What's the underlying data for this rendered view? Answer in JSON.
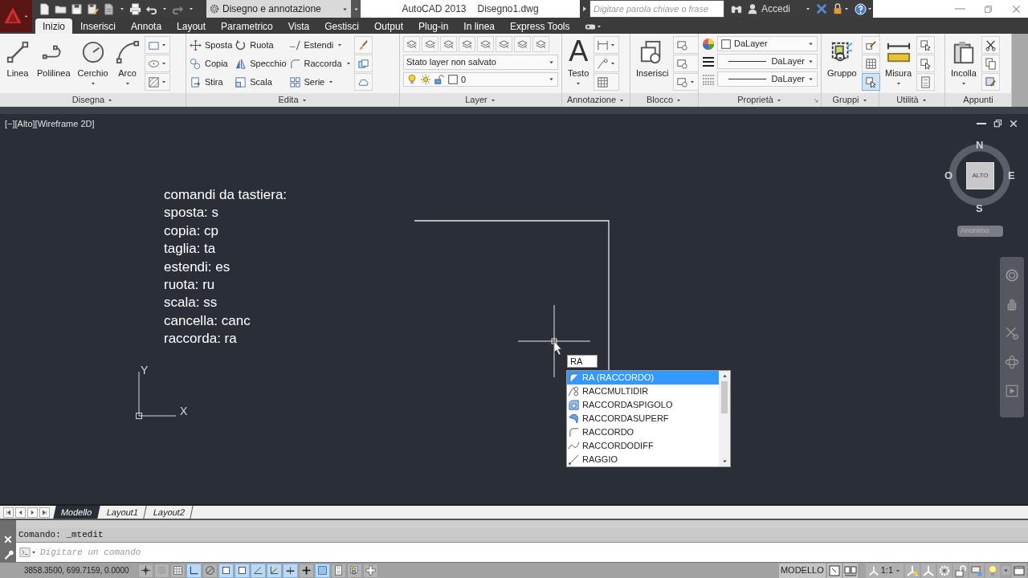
{
  "title_bar": {
    "workspace": "Disegno e annotazione",
    "app_title": "AutoCAD 2013",
    "file_name": "Disegno1.dwg",
    "search": {
      "placeholder": "Digitare parola chiave o frase"
    },
    "sign_in": "Accedi"
  },
  "ribbon_tabs": [
    {
      "label": "Inizio",
      "selected": true
    },
    {
      "label": "Inserisci",
      "selected": false
    },
    {
      "label": "Annota",
      "selected": false
    },
    {
      "label": "Layout",
      "selected": false
    },
    {
      "label": "Parametrico",
      "selected": false
    },
    {
      "label": "Vista",
      "selected": false
    },
    {
      "label": "Gestisci",
      "selected": false
    },
    {
      "label": "Output",
      "selected": false
    },
    {
      "label": "Plug-in",
      "selected": false
    },
    {
      "label": "In linea",
      "selected": false
    },
    {
      "label": "Express Tools",
      "selected": false
    }
  ],
  "ribbon_panels": [
    {
      "title": "Disegna",
      "menu": true,
      "launcher": false,
      "columns": [
        [
          {
            "kind": "large",
            "label": "Linea",
            "menu": false
          }
        ],
        [
          {
            "kind": "large",
            "label": "Polilinea",
            "menu": false
          }
        ],
        [
          {
            "kind": "large",
            "label": "Cerchio",
            "menu": true
          }
        ],
        [
          {
            "kind": "large",
            "label": "Arco",
            "menu": true
          }
        ],
        [
          {
            "kind": "tool",
            "menu": true
          },
          {
            "kind": "tool",
            "menu": true
          },
          {
            "kind": "tool",
            "menu": true
          }
        ]
      ]
    },
    {
      "title": "Edita",
      "menu": true,
      "launcher": false,
      "columns": [
        [
          {
            "kind": "small",
            "label": "Sposta",
            "menu": false
          },
          {
            "kind": "small",
            "label": "Copia",
            "menu": false
          },
          {
            "kind": "small",
            "label": "Stira",
            "menu": false
          }
        ],
        [
          {
            "kind": "small",
            "label": "Ruota",
            "menu": false
          },
          {
            "kind": "small",
            "label": "Specchio",
            "menu": false
          },
          {
            "kind": "small",
            "label": "Scala",
            "menu": false
          }
        ],
        [
          {
            "kind": "small",
            "label": "Estendi",
            "menu": true
          },
          {
            "kind": "small",
            "label": "Raccorda",
            "menu": true
          },
          {
            "kind": "small",
            "label": "Serie",
            "menu": true
          }
        ],
        [
          {
            "kind": "tool",
            "menu": false
          },
          {
            "kind": "tool",
            "menu": false
          },
          {
            "kind": "tool",
            "menu": false
          }
        ]
      ]
    },
    {
      "title": "Layer",
      "menu": true,
      "launcher": false,
      "columns": [
        [
          {
            "kind": "toolrow",
            "tools": [
              {
                "menu": false
              },
              {
                "menu": false
              },
              {
                "menu": false
              },
              {
                "menu": false
              },
              {
                "menu": false
              },
              {
                "menu": false
              },
              {
                "menu": false
              },
              {
                "menu": false
              }
            ]
          },
          {
            "kind": "select",
            "value": "Stato layer non salvato"
          },
          {
            "kind": "layer_select",
            "value": "0"
          }
        ]
      ]
    },
    {
      "title": "Annotazione",
      "menu": true,
      "launcher": false,
      "columns": [
        [
          {
            "kind": "large",
            "label": "Testo",
            "glyph": "A",
            "menu": true
          }
        ],
        [
          {
            "kind": "tool",
            "menu": true
          },
          {
            "kind": "tool",
            "menu": true
          },
          {
            "kind": "tool",
            "menu": false
          }
        ]
      ]
    },
    {
      "title": "Blocco",
      "menu": true,
      "launcher": false,
      "columns": [
        [
          {
            "kind": "large",
            "label": "Inserisci",
            "menu": false
          }
        ],
        [
          {
            "kind": "tool",
            "menu": false
          },
          {
            "kind": "tool",
            "menu": false
          },
          {
            "kind": "tool",
            "menu": true
          }
        ]
      ]
    },
    {
      "title": "Proprietà",
      "menu": true,
      "launcher": true,
      "columns": [
        [
          {
            "kind": "color_select",
            "value": "DaLayer"
          },
          {
            "kind": "lineweight_select",
            "value": "DaLayer"
          },
          {
            "kind": "linetype_select",
            "value": "DaLayer"
          }
        ]
      ]
    },
    {
      "title": "Gruppi",
      "menu": true,
      "launcher": false,
      "columns": [
        [
          {
            "kind": "large",
            "label": "Gruppo",
            "menu": false
          }
        ],
        [
          {
            "kind": "tool",
            "menu": false,
            "active": false
          },
          {
            "kind": "tool",
            "menu": false,
            "active": false
          },
          {
            "kind": "tool",
            "menu": false,
            "active": true
          }
        ]
      ]
    },
    {
      "title": "Utilità",
      "menu": true,
      "launcher": false,
      "columns": [
        [
          {
            "kind": "large",
            "label": "Misura",
            "menu": true
          }
        ],
        [
          {
            "kind": "tool",
            "menu": false
          },
          {
            "kind": "tool",
            "menu": false
          },
          {
            "kind": "tool",
            "menu": false
          }
        ]
      ]
    },
    {
      "title": "Appunti",
      "menu": false,
      "launcher": false,
      "columns": [
        [
          {
            "kind": "large",
            "label": "Incolla",
            "menu": true
          }
        ],
        [
          {
            "kind": "tool",
            "menu": false
          },
          {
            "kind": "tool",
            "menu": false
          },
          {
            "kind": "tool",
            "menu": false
          }
        ]
      ]
    }
  ],
  "viewport": {
    "controls": "[−][Alto][Wireframe 2D]",
    "notes": [
      "comandi da tastiera:",
      "sposta: s",
      "copia: cp",
      "taglia: ta",
      "estendi: es",
      "ruota: ru",
      "scala: ss",
      "cancella: canc",
      "raccorda: ra"
    ],
    "ucs": {
      "x_label": "X",
      "y_label": "Y"
    },
    "viewcube": {
      "north": "N",
      "east": "E",
      "south": "S",
      "west": "O",
      "face": "ALTO",
      "ucs_menu": "Anonimo"
    },
    "dynamic_input": {
      "value": "RA"
    },
    "suggestions": [
      {
        "label": "RA (RACCORDO)",
        "selected": true
      },
      {
        "label": "RACCMULTIDIR",
        "selected": false
      },
      {
        "label": "RACCORDASPIGOLO",
        "selected": false
      },
      {
        "label": "RACCORDASUPERF",
        "selected": false
      },
      {
        "label": "RACCORDO",
        "selected": false
      },
      {
        "label": "RACCORDODIFF",
        "selected": false
      },
      {
        "label": "RAGGIO",
        "selected": false
      }
    ]
  },
  "layout_tabs": [
    {
      "label": "Modello",
      "selected": true
    },
    {
      "label": "Layout1",
      "selected": false
    },
    {
      "label": "Layout2",
      "selected": false
    }
  ],
  "command_line": {
    "history": "Comando: _mtedit",
    "input": {
      "placeholder": "Digitare un comando"
    }
  },
  "status_bar": {
    "coordinates": "3858.3500, 699.7159, 0.0000",
    "toggles": [
      {
        "on": false
      },
      {
        "on": false
      },
      {
        "on": false
      },
      {
        "on": true
      },
      {
        "on": false
      },
      {
        "on": true
      },
      {
        "on": true
      },
      {
        "on": true
      },
      {
        "on": true
      },
      {
        "on": true
      },
      {
        "on": false
      },
      {
        "on": true
      },
      {
        "on": false
      },
      {
        "on": false
      },
      {
        "on": false
      }
    ],
    "space": "MODELLO",
    "annotation_scale": "1:1"
  }
}
